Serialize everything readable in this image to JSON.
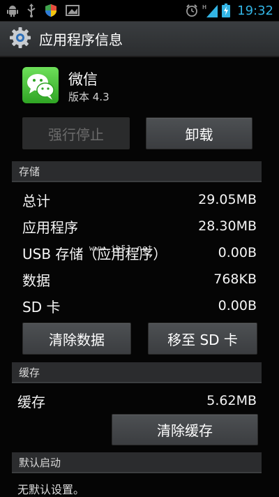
{
  "status_bar": {
    "time": "19:32",
    "network_label": "H",
    "icons": [
      "android-debug-icon",
      "usb-icon",
      "security-shield-icon",
      "screenshot-icon",
      "alarm-clock-icon",
      "signal-icon",
      "battery-icon"
    ]
  },
  "action_bar": {
    "title": "应用程序信息",
    "icon": "settings-gear-icon"
  },
  "app": {
    "name": "微信",
    "version": "版本 4.3",
    "icon": "wechat-icon"
  },
  "top_buttons": {
    "force_stop": "强行停止",
    "uninstall": "卸载"
  },
  "storage": {
    "header": "存储",
    "rows": [
      {
        "label": "总计",
        "value": "29.05MB"
      },
      {
        "label": "应用程序",
        "value": "28.30MB"
      },
      {
        "label": "USB 存储（应用程序）",
        "value": "0.00B"
      },
      {
        "label": "数据",
        "value": "768KB"
      },
      {
        "label": "SD 卡",
        "value": "0.00B"
      }
    ],
    "clear_data_button": "清除数据",
    "move_to_sd_button": "移至 SD 卡"
  },
  "watermark": "www.jb51.net",
  "cache": {
    "header": "缓存",
    "label": "缓存",
    "value": "5.62MB",
    "clear_cache_button": "清除缓存"
  },
  "default_launch": {
    "header": "默认启动",
    "text": "无默认设置。"
  },
  "colors": {
    "accent": "#33b5e5",
    "app_icon_green": "#3fbf2f"
  }
}
